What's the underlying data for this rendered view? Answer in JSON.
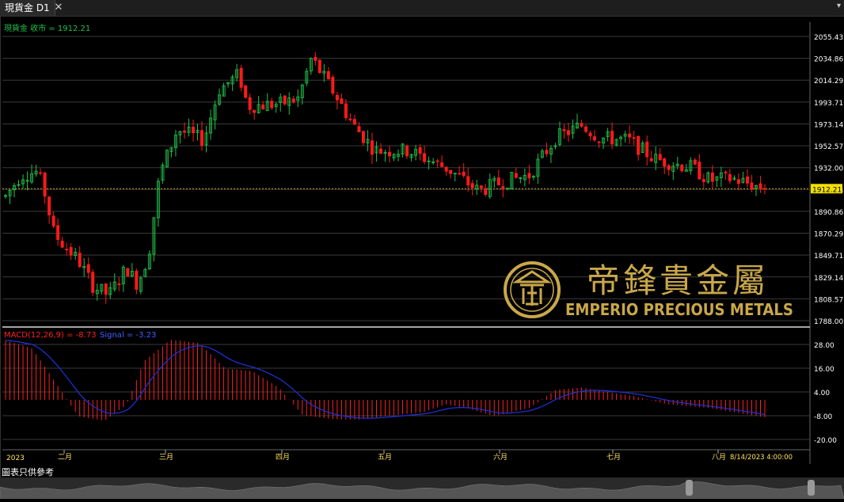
{
  "window": {
    "tab_title": "現貨金 D1",
    "close_glyph": "✕",
    "menu_glyph": "▾"
  },
  "main_pane": {
    "series_label": "現貨金 收市 = 1912.21",
    "current_price": "1912.21",
    "price_axis": [
      "2055.43",
      "2034.86",
      "2014.29",
      "1993.71",
      "1973.14",
      "1952.57",
      "1932.00",
      "1911.43",
      "1890.86",
      "1870.29",
      "1849.71",
      "1829.14",
      "1808.57",
      "1788.00"
    ],
    "colors": {
      "up": "#1fc24a",
      "down": "#ff1a1a",
      "current_line": "#c8a020",
      "grid": "#3a3a3a"
    }
  },
  "watermark": {
    "chinese": "帝鋒貴金屬",
    "english": "EMPERIO PRECIOUS METALS",
    "color": "#c9a74a"
  },
  "macd_pane": {
    "label": "MACD(12,26,9) = -8.73",
    "signal_label": "Signal = -3.23",
    "axis": [
      "28.00",
      "16.00",
      "4.00",
      "-8.00",
      "-20.00"
    ],
    "colors": {
      "histogram": "#ff2020",
      "signal": "#1d2fd0",
      "label": "#ff2020"
    }
  },
  "time_axis": {
    "year": "2023",
    "months": [
      "二月",
      "三月",
      "四月",
      "五月",
      "六月",
      "七月",
      "八月"
    ],
    "cursor_date": "8/14/2023 4:00:00"
  },
  "footer": {
    "note": "圖表只供參考"
  }
}
